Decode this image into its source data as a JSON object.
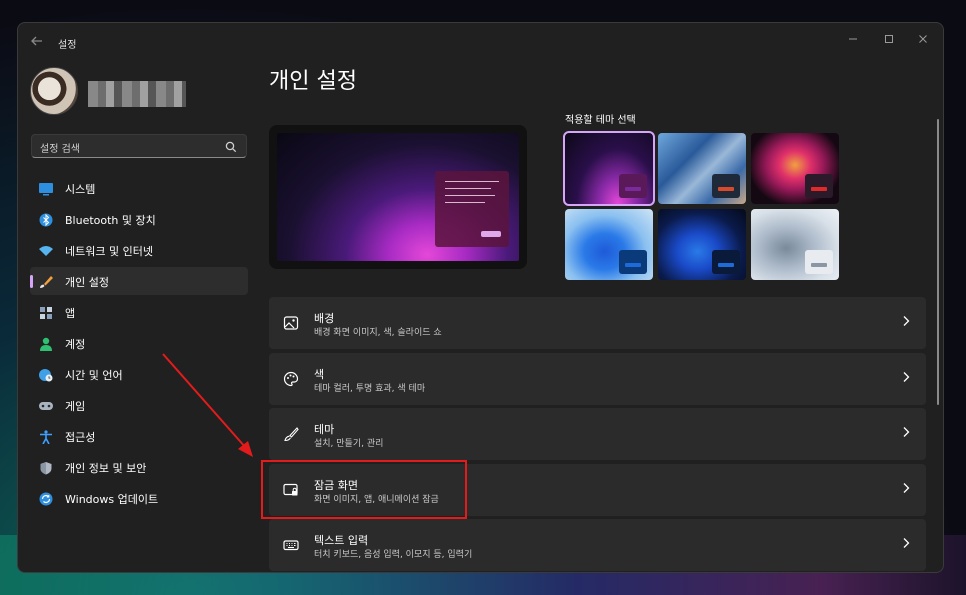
{
  "window": {
    "title": "설정",
    "back_icon": "back-arrow-icon",
    "controls": [
      "minimize",
      "maximize",
      "close"
    ]
  },
  "sidebar": {
    "search_placeholder": "설정 검색",
    "items": [
      {
        "label": "시스템",
        "icon": "system-icon",
        "color": "#2e8fe0"
      },
      {
        "label": "Bluetooth 및 장치",
        "icon": "bluetooth-icon",
        "color": "#2e8fe0"
      },
      {
        "label": "네트워크 및 인터넷",
        "icon": "wifi-icon",
        "color": "#56b4f0"
      },
      {
        "label": "개인 설정",
        "icon": "brush-icon",
        "color": "#f0a040",
        "active": true
      },
      {
        "label": "앱",
        "icon": "apps-icon",
        "color": "#8a9fb8"
      },
      {
        "label": "계정",
        "icon": "account-icon",
        "color": "#2fbf71"
      },
      {
        "label": "시간 및 언어",
        "icon": "globe-clock-icon",
        "color": "#3fa0e8"
      },
      {
        "label": "게임",
        "icon": "gamepad-icon",
        "color": "#aab4c0"
      },
      {
        "label": "접근성",
        "icon": "accessibility-icon",
        "color": "#3fa0ff"
      },
      {
        "label": "개인 정보 및 보안",
        "icon": "shield-icon",
        "color": "#b0b8c4"
      },
      {
        "label": "Windows 업데이트",
        "icon": "update-icon",
        "color": "#2e8fe0"
      }
    ]
  },
  "main": {
    "title": "개인 설정",
    "theme_heading": "적용할 테마 선택",
    "themes": [
      {
        "name": "glow-dark",
        "badge": "#5a1a5a",
        "accent": "#7a2a9a",
        "selected": true
      },
      {
        "name": "chefchaouen",
        "badge": "#1e2a3a",
        "accent": "#d84a2a"
      },
      {
        "name": "flower",
        "badge": "#2a1a2a",
        "accent": "#e02a2a"
      },
      {
        "name": "bloom-light",
        "badge": "#0a3a7a",
        "accent": "#1e6ad8"
      },
      {
        "name": "bloom-dark",
        "badge": "#0a1a3a",
        "accent": "#1e6ad8"
      },
      {
        "name": "captured-motion",
        "badge": "#e8ecf0",
        "accent": "#8a96a4"
      }
    ],
    "cards": [
      {
        "title": "배경",
        "subtitle": "배경 화면 이미지, 색, 슬라이드 쇼",
        "icon": "image-icon"
      },
      {
        "title": "색",
        "subtitle": "테마 컬러, 투명 효과, 색 테마",
        "icon": "palette-icon"
      },
      {
        "title": "테마",
        "subtitle": "설치, 만들기, 관리",
        "icon": "brush-icon"
      },
      {
        "title": "잠금 화면",
        "subtitle": "화면 이미지, 앱, 애니메이션 잠금",
        "icon": "lock-screen-icon"
      },
      {
        "title": "텍스트 입력",
        "subtitle": "터치 키보드, 음성 입력, 이모지 등, 입력기",
        "icon": "keyboard-icon"
      }
    ]
  },
  "colors": {
    "accent": "#d7a5f7",
    "annotation": "#e31b1b"
  }
}
